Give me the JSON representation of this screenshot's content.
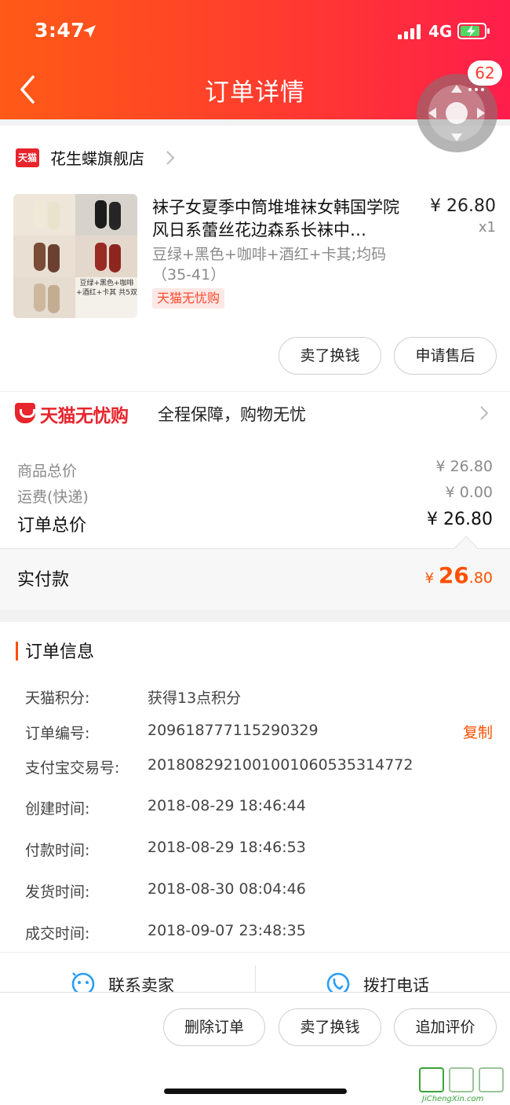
{
  "status_bar": {
    "time": "3:47",
    "network": "4G"
  },
  "nav": {
    "title": "订单详情",
    "badge_count": "62"
  },
  "store": {
    "icon_text": "天猫",
    "name": "花生蝶旗舰店"
  },
  "product": {
    "title": "袜子女夏季中筒堆堆袜女韩国学院风日系蕾丝花边森系长袜中…",
    "price": "¥ 26.80",
    "qty": "x1",
    "spec": "豆绿+黑色+咖啡+酒红+卡其;均码（35-41）",
    "tag": "天猫无忧购",
    "image_caption": "豆绿+黑色+咖啡+酒红+卡其 共5双"
  },
  "item_actions": {
    "sell": "卖了换钱",
    "after_sale": "申请售后"
  },
  "guarantee": {
    "logo": "天猫无忧购",
    "desc": "全程保障，购物无忧"
  },
  "summary": {
    "goods_label": "商品总价",
    "goods_value": "¥ 26.80",
    "shipping_label": "运费(快递)",
    "shipping_value": "¥ 0.00",
    "total_label": "订单总价",
    "total_value": "¥ 26.80",
    "paid_label": "实付款",
    "paid_symbol": "¥ ",
    "paid_int": "26",
    "paid_dec": ".80"
  },
  "order_info": {
    "title": "订单信息",
    "copy_label": "复制",
    "rows": [
      {
        "label": "天猫积分:",
        "value": "获得13点积分"
      },
      {
        "label": "订单编号:",
        "value": "209618777115290329"
      },
      {
        "label": "支付宝交易号:",
        "value": "2018082921001001060535314772"
      },
      {
        "label": "创建时间:",
        "value": "2018-08-29 18:46:44"
      },
      {
        "label": "付款时间:",
        "value": "2018-08-29 18:46:53"
      },
      {
        "label": "发货时间:",
        "value": "2018-08-30 08:04:46"
      },
      {
        "label": "成交时间:",
        "value": "2018-09-07 23:48:35"
      }
    ]
  },
  "contact": {
    "seller": "联系卖家",
    "phone": "拨打电话"
  },
  "bottom_actions": {
    "delete": "删除订单",
    "sell": "卖了换钱",
    "review": "追加评价"
  },
  "watermark": {
    "text": "JiChengXin.com"
  },
  "colors": {
    "accent": "#ff5000",
    "tmall_red": "#e8242c",
    "header_start": "#ff5a16",
    "header_end": "#ff1e4b"
  }
}
